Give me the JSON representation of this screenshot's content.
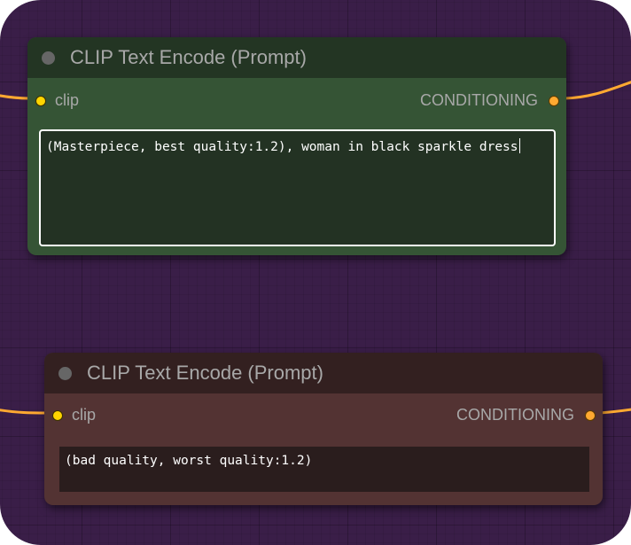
{
  "colors": {
    "canvas_bg": "#3a1e48",
    "link_color": "#ffa931",
    "positive_node_header": "#233523",
    "positive_node_body": "#355435",
    "negative_node_header": "#332020",
    "negative_node_body": "#533333"
  },
  "nodes": [
    {
      "title": "CLIP Text Encode (Prompt)",
      "input_label": "clip",
      "output_label": "CONDITIONING",
      "text": "(Masterpiece, best quality:1.2), woman in black sparkle dress",
      "focused": true
    },
    {
      "title": "CLIP Text Encode (Prompt)",
      "input_label": "clip",
      "output_label": "CONDITIONING",
      "text": "(bad quality, worst quality:1.2)",
      "focused": false
    }
  ]
}
